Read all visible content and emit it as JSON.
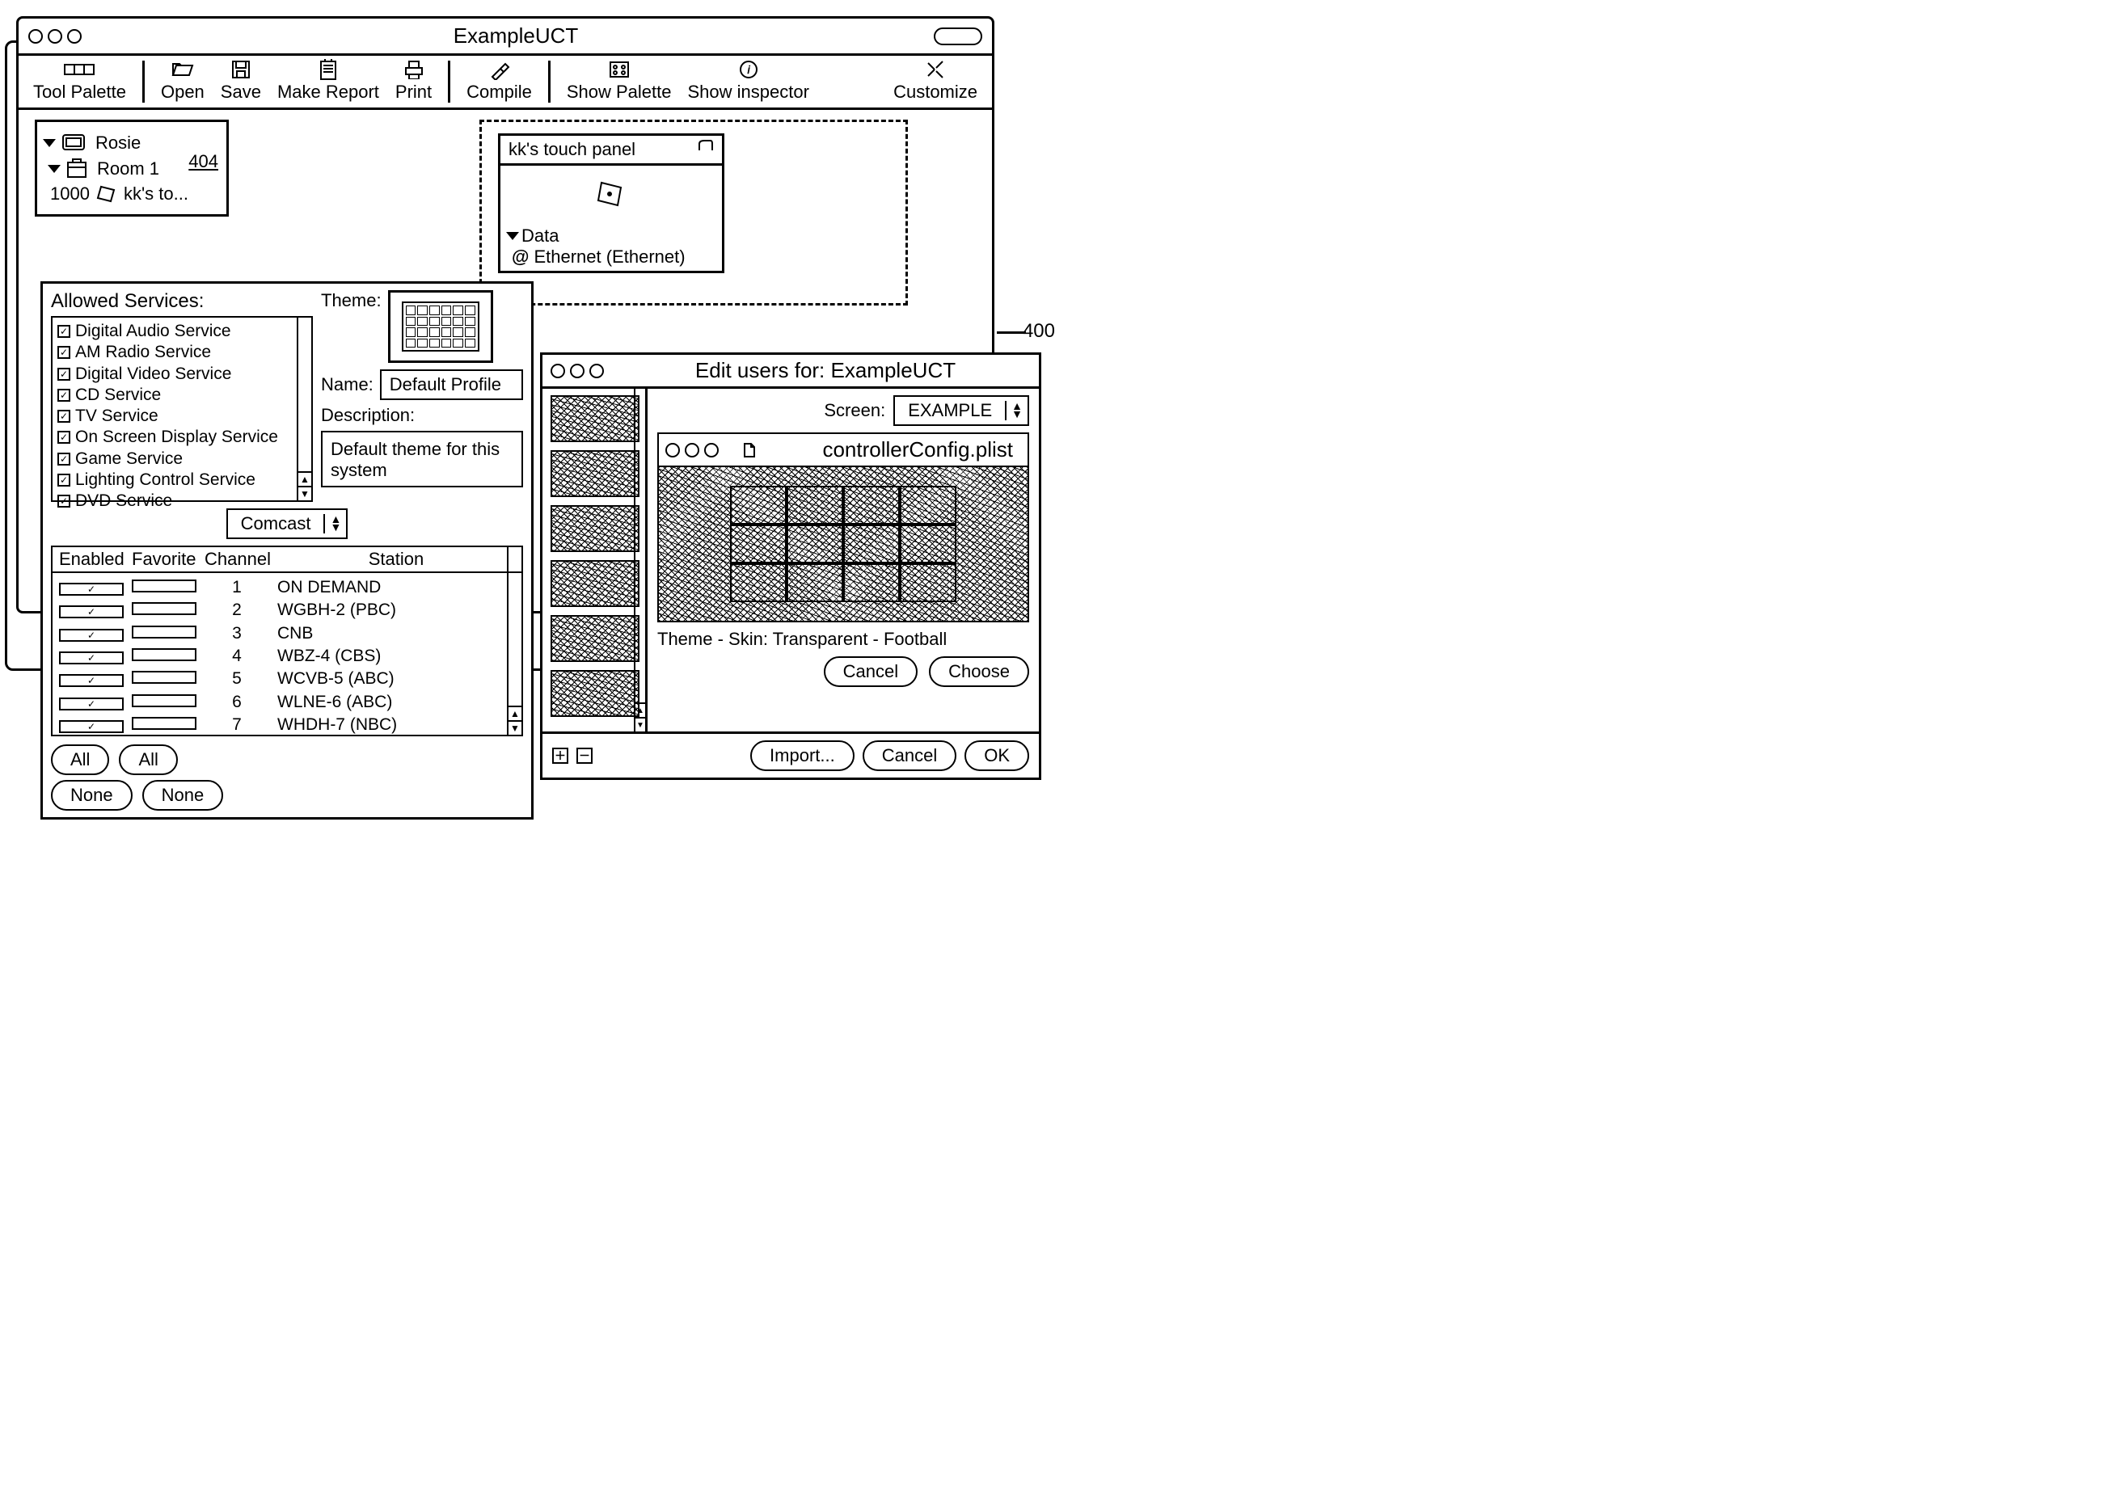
{
  "window": {
    "title": "ExampleUCT"
  },
  "toolbar": {
    "tool_palette": "Tool Palette",
    "open": "Open",
    "save": "Save",
    "make_report": "Make Report",
    "print": "Print",
    "compile": "Compile",
    "show_palette": "Show Palette",
    "show_inspector": "Show inspector",
    "customize": "Customize"
  },
  "tree": {
    "rosie": "Rosie",
    "ref404": "404",
    "room1": "Room 1",
    "ref1000": "1000",
    "kks": "kk's to..."
  },
  "canvas": {
    "touchpanel_title": "kk's touch panel",
    "data": "Data",
    "ethernet": "Ethernet (Ethernet)"
  },
  "ref400": "400",
  "services": {
    "heading": "Allowed Services:",
    "items": [
      "Digital Audio Service",
      "AM Radio Service",
      "Digital Video Service",
      "CD Service",
      "TV Service",
      "On Screen Display Service",
      "Game Service",
      "Lighting Control Service",
      "DVD Service"
    ],
    "theme_label": "Theme:",
    "name_label": "Name:",
    "name_value": "Default Profile",
    "desc_label": "Description:",
    "desc_value": "Default theme for this system",
    "provider": "Comcast",
    "cols": {
      "enabled": "Enabled",
      "favorite": "Favorite",
      "channel": "Channel",
      "station": "Station"
    },
    "channels": [
      {
        "n": "1",
        "s": "ON DEMAND"
      },
      {
        "n": "2",
        "s": "WGBH-2 (PBC)"
      },
      {
        "n": "3",
        "s": "CNB"
      },
      {
        "n": "4",
        "s": "WBZ-4 (CBS)"
      },
      {
        "n": "5",
        "s": "WCVB-5 (ABC)"
      },
      {
        "n": "6",
        "s": "WLNE-6 (ABC)"
      },
      {
        "n": "7",
        "s": "WHDH-7 (NBC)"
      }
    ],
    "all": "All",
    "none": "None"
  },
  "editusers": {
    "title": "Edit users for: ExampleUCT",
    "screen_label": "Screen:",
    "screen_value": "EXAMPLE",
    "config_file": "controllerConfig.plist",
    "theme_skin": "Theme - Skin: Transparent - Football",
    "cancel": "Cancel",
    "choose": "Choose",
    "import": "Import...",
    "ok": "OK"
  }
}
